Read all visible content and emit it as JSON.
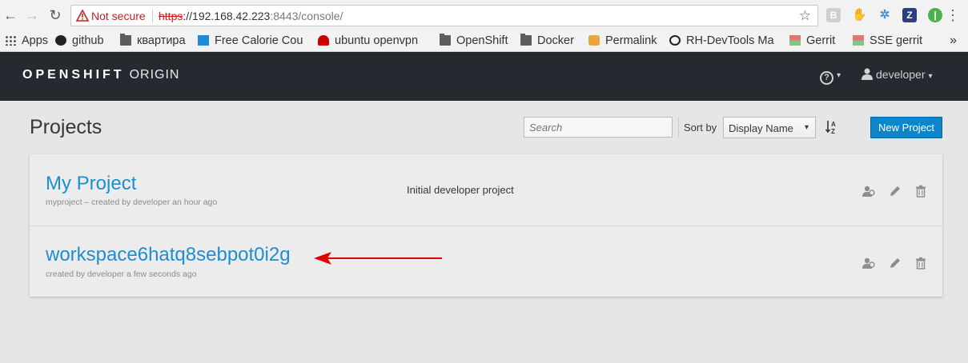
{
  "browser": {
    "not_secure": "Not secure",
    "url_scheme": "https",
    "url_host": "://192.168.42.223",
    "url_rest": ":8443/console/",
    "bookmarks": [
      {
        "label": "Apps",
        "icon": "apps-grid-icon"
      },
      {
        "label": "github",
        "icon": "github-icon"
      },
      {
        "label": "квартира",
        "icon": "folder-icon"
      },
      {
        "label": "Free Calorie Cou",
        "icon": "calorie-icon"
      },
      {
        "label": "ubuntu openvpn",
        "icon": "redhat-icon"
      },
      {
        "label": "OpenShift",
        "icon": "folder-icon"
      },
      {
        "label": "Docker",
        "icon": "folder-icon"
      },
      {
        "label": "Permalink",
        "icon": "permalink-icon"
      },
      {
        "label": "RH-DevTools Ma",
        "icon": "devtools-icon"
      },
      {
        "label": "Gerrit",
        "icon": "gerrit-icon"
      },
      {
        "label": "SSE gerrit",
        "icon": "gerrit-icon"
      }
    ],
    "more_bookmarks": "»"
  },
  "masthead": {
    "brand_bold": "OPENSHIFT",
    "brand_light": "ORIGIN",
    "help_glyph": "?",
    "user": "developer"
  },
  "page": {
    "title": "Projects",
    "search_placeholder": "Search",
    "sort_label": "Sort by",
    "sort_value": "Display Name",
    "new_project": "New Project"
  },
  "projects": [
    {
      "name": "My Project",
      "meta": "myproject – created by developer an hour ago",
      "description": "Initial developer project"
    },
    {
      "name": "workspace6hatq8sebpot0i2g",
      "meta": "created by developer a few seconds ago",
      "description": ""
    }
  ],
  "colors": {
    "masthead": "#252a30",
    "link": "#1d8ed2",
    "primary_button": "#0e85c9",
    "annotation_arrow": "#e00000"
  }
}
